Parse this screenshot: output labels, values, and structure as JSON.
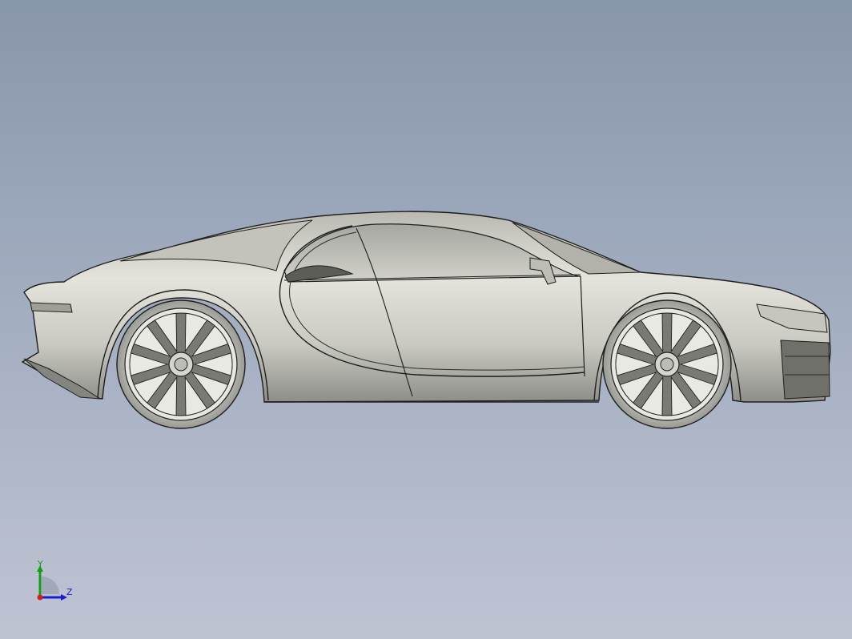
{
  "viewport": {
    "background_top": "#8896ab",
    "background_bottom": "#bfc4d3"
  },
  "model": {
    "body_color": "#d6d6cf",
    "edge_color": "#1e1e1e"
  },
  "triad": {
    "y_label": "Y",
    "z_label": "Z",
    "y_color": "#1a9a1a",
    "z_color": "#1b1bd0",
    "origin_color": "#d02020"
  }
}
